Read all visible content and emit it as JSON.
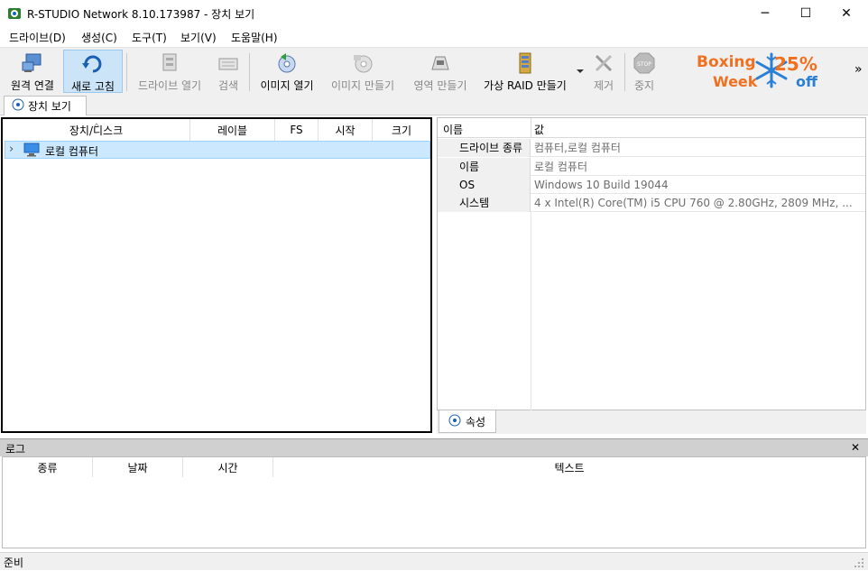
{
  "window": {
    "title": "R-STUDIO Network 8.10.173987 - 장치 보기",
    "minimize": "─",
    "maximize": "☐",
    "close": "✕"
  },
  "menu": [
    "드라이브(D)",
    "생성(C)",
    "도구(T)",
    "보기(V)",
    "도움말(H)"
  ],
  "toolbar": {
    "remote_connect": "원격 연결",
    "refresh": "새로 고침",
    "open_drive": "드라이브 열기",
    "search": "검색",
    "open_image": "이미지 열기",
    "create_image": "이미지 만들기",
    "create_region": "영역 만들기",
    "create_raid": "가상 RAID 만들기",
    "remove": "제거",
    "stop": "중지",
    "more": "»"
  },
  "promo": {
    "line1": "Boxing",
    "line2": "Week",
    "percent": "25%",
    "off": "off",
    "color_blue": "#2a7fd6",
    "color_orange": "#f07020"
  },
  "tabs": {
    "devices": "장치 보기",
    "properties": "속성"
  },
  "device_table": {
    "columns": [
      "장치/디스크",
      "레이블",
      "FS",
      "시작",
      "크기"
    ],
    "rows": [
      {
        "expander": "›",
        "name": "로컬 컴퓨터"
      }
    ]
  },
  "properties": {
    "header_name": "이름",
    "header_value": "값",
    "rows": [
      {
        "name": "드라이브 종류",
        "value": "컴퓨터,로컬 컴퓨터"
      },
      {
        "name": "이름",
        "value": "로컬 컴퓨터"
      },
      {
        "name": "OS",
        "value": "Windows 10 Build 19044"
      },
      {
        "name": "시스템",
        "value": "4 x Intel(R) Core(TM) i5 CPU       760  @ 2.80GHz, 2809 MHz, ..."
      }
    ]
  },
  "log": {
    "title": "로그",
    "close": "✕",
    "columns": [
      "종류",
      "날짜",
      "시간",
      "텍스트"
    ]
  },
  "status": {
    "text": "준비"
  },
  "colors": {
    "selection": "#cce8ff",
    "accent": "#0078d7"
  }
}
